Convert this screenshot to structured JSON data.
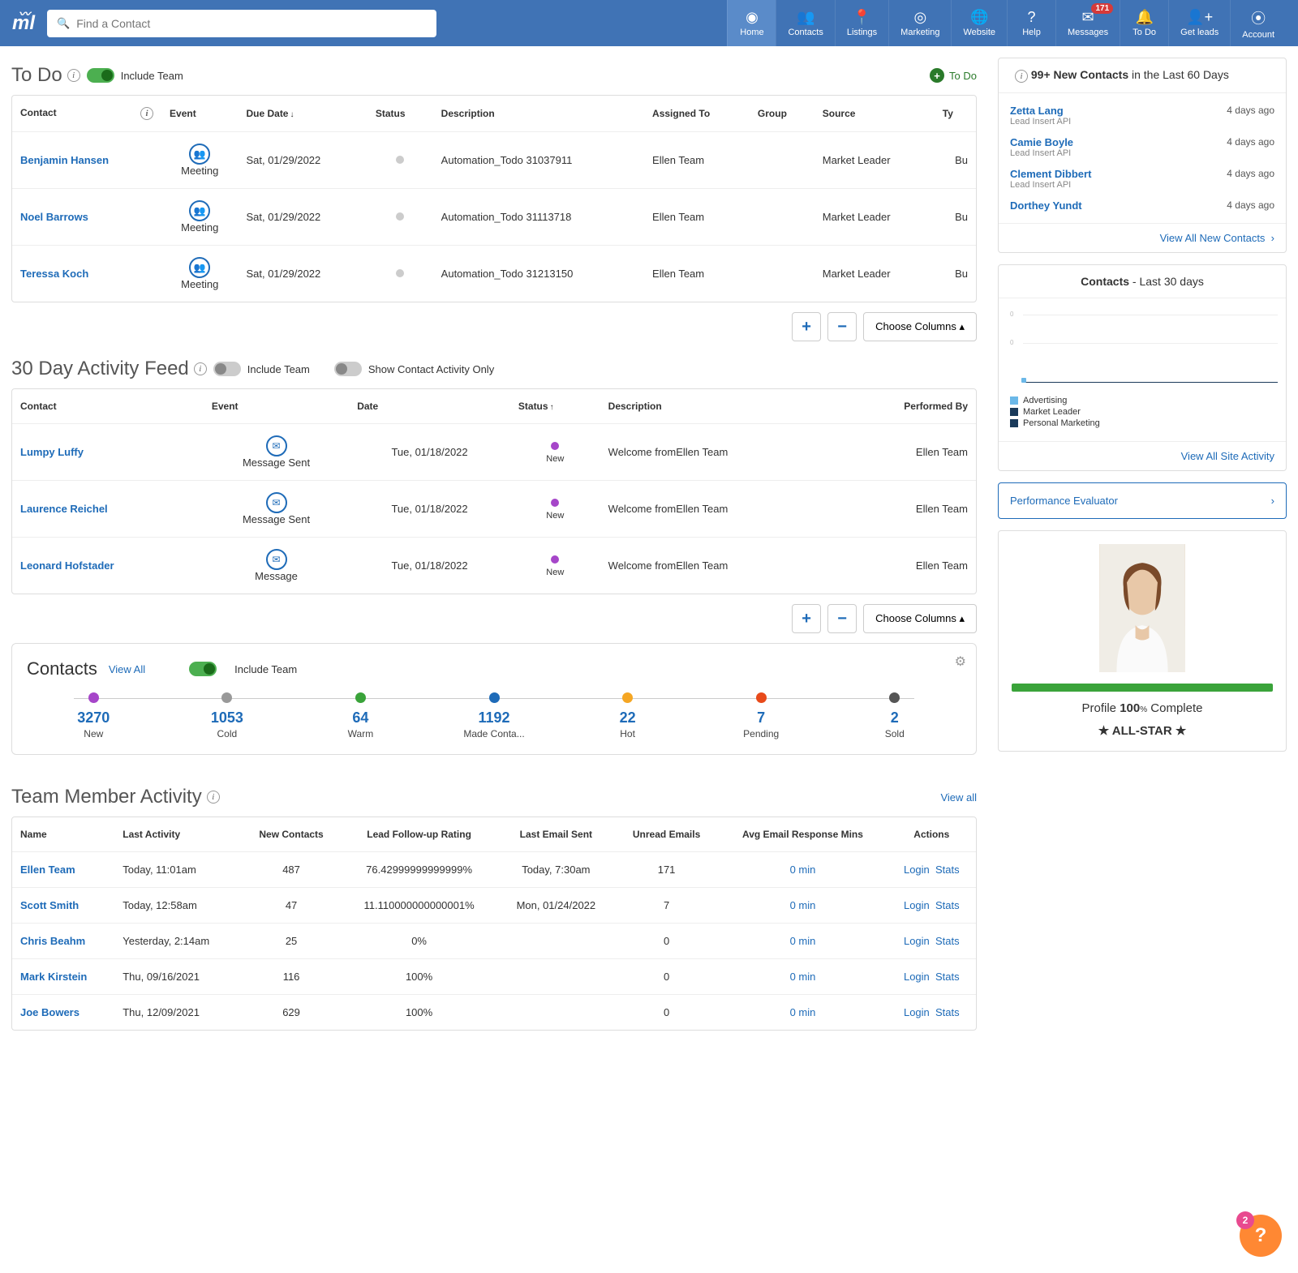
{
  "search": {
    "placeholder": "Find a Contact"
  },
  "topnav": [
    {
      "label": "Home",
      "icon": "◉",
      "active": true
    },
    {
      "label": "Contacts",
      "icon": "👥"
    },
    {
      "label": "Listings",
      "icon": "📍"
    },
    {
      "label": "Marketing",
      "icon": "◎"
    },
    {
      "label": "Website",
      "icon": "🌐"
    },
    {
      "label": "Help",
      "icon": "?"
    },
    {
      "label": "Messages",
      "icon": "✉",
      "badge": "171"
    },
    {
      "label": "To Do",
      "icon": "🔔"
    },
    {
      "label": "Get leads",
      "icon": "👤+"
    },
    {
      "label": "Account",
      "icon": "⦿"
    }
  ],
  "todo": {
    "title": "To Do",
    "include_team_label": "Include Team",
    "add_label": "To Do",
    "columns": [
      "Contact",
      "Event",
      "Due Date",
      "Status",
      "Description",
      "Assigned To",
      "Group",
      "Source",
      "Ty"
    ],
    "rows": [
      {
        "contact": "Benjamin Hansen",
        "event": "Meeting",
        "due": "Sat, 01/29/2022",
        "desc": "Automation_Todo 31037911",
        "assigned": "Ellen Team",
        "group": "",
        "source": "Market Leader",
        "type": "Bu"
      },
      {
        "contact": "Noel Barrows",
        "event": "Meeting",
        "due": "Sat, 01/29/2022",
        "desc": "Automation_Todo 31113718",
        "assigned": "Ellen Team",
        "group": "",
        "source": "Market Leader",
        "type": "Bu"
      },
      {
        "contact": "Teressa Koch",
        "event": "Meeting",
        "due": "Sat, 01/29/2022",
        "desc": "Automation_Todo 31213150",
        "assigned": "Ellen Team",
        "group": "",
        "source": "Market Leader",
        "type": "Bu"
      }
    ],
    "choose_columns": "Choose Columns"
  },
  "activity": {
    "title": "30 Day Activity Feed",
    "include_team_label": "Include Team",
    "contact_only_label": "Show Contact Activity Only",
    "columns": [
      "Contact",
      "Event",
      "Date",
      "Status",
      "Description",
      "Performed By"
    ],
    "rows": [
      {
        "contact": "Lumpy Luffy",
        "event": "Message Sent",
        "date": "Tue, 01/18/2022",
        "status": "New",
        "desc": "Welcome fromEllen Team",
        "by": "Ellen Team"
      },
      {
        "contact": "Laurence Reichel",
        "event": "Message Sent",
        "date": "Tue, 01/18/2022",
        "status": "New",
        "desc": "Welcome fromEllen Team",
        "by": "Ellen Team"
      },
      {
        "contact": "Leonard Hofstader",
        "event": "Message",
        "date": "Tue, 01/18/2022",
        "status": "New",
        "desc": "Welcome fromEllen Team",
        "by": "Ellen Team"
      }
    ],
    "choose_columns": "Choose Columns"
  },
  "contacts": {
    "title": "Contacts",
    "view_all": "View All",
    "include_team_label": "Include Team",
    "stages": [
      {
        "count": "3270",
        "name": "New",
        "color": "#a646c9"
      },
      {
        "count": "1053",
        "name": "Cold",
        "color": "#999"
      },
      {
        "count": "64",
        "name": "Warm",
        "color": "#3aa33a"
      },
      {
        "count": "1192",
        "name": "Made Conta...",
        "color": "#1e6bb8"
      },
      {
        "count": "22",
        "name": "Hot",
        "color": "#f5a623"
      },
      {
        "count": "7",
        "name": "Pending",
        "color": "#e84a1a"
      },
      {
        "count": "2",
        "name": "Sold",
        "color": "#555"
      }
    ]
  },
  "team": {
    "title": "Team Member Activity",
    "view_all": "View all",
    "columns": [
      "Name",
      "Last Activity",
      "New Contacts",
      "Lead Follow-up Rating",
      "Last Email Sent",
      "Unread Emails",
      "Avg Email Response Mins",
      "Actions"
    ],
    "rows": [
      {
        "name": "Ellen Team",
        "last": "Today, 11:01am",
        "new": "487",
        "rating": "76.42999999999999%",
        "sent": "Today, 7:30am",
        "unread": "171",
        "avg": "0 min"
      },
      {
        "name": "Scott Smith",
        "last": "Today, 12:58am",
        "new": "47",
        "rating": "11.110000000000001%",
        "sent": "Mon, 01/24/2022",
        "unread": "7",
        "avg": "0 min"
      },
      {
        "name": "Chris Beahm",
        "last": "Yesterday, 2:14am",
        "new": "25",
        "rating": "0%",
        "sent": "",
        "unread": "0",
        "avg": "0 min"
      },
      {
        "name": "Mark Kirstein",
        "last": "Thu, 09/16/2021",
        "new": "116",
        "rating": "100%",
        "sent": "",
        "unread": "0",
        "avg": "0 min"
      },
      {
        "name": "Joe Bowers",
        "last": "Thu, 12/09/2021",
        "new": "629",
        "rating": "100%",
        "sent": "",
        "unread": "0",
        "avg": "0 min"
      }
    ],
    "login": "Login",
    "stats": "Stats"
  },
  "new_contacts": {
    "header_bold": "99+ New Contacts",
    "header_rest": " in the Last 60 Days",
    "rows": [
      {
        "name": "Zetta Lang",
        "sub": "Lead Insert API",
        "time": "4 days ago"
      },
      {
        "name": "Camie Boyle",
        "sub": "Lead Insert API",
        "time": "4 days ago"
      },
      {
        "name": "Clement Dibbert",
        "sub": "Lead Insert API",
        "time": "4 days ago"
      },
      {
        "name": "Dorthey Yundt",
        "sub": "",
        "time": "4 days ago"
      }
    ],
    "footer": "View All New Contacts"
  },
  "contacts_chart": {
    "header_bold": "Contacts",
    "header_rest": " - Last 30 days",
    "legend": [
      {
        "label": "Advertising",
        "color": "#6bb8e8"
      },
      {
        "label": "Market Leader",
        "color": "#1a3a5a"
      },
      {
        "label": "Personal Marketing",
        "color": "#1a3a5a"
      }
    ],
    "footer": "View All Site Activity"
  },
  "perf": {
    "label": "Performance Evaluator"
  },
  "profile": {
    "text_pre": "Profile ",
    "pct": "100",
    "unit": "%",
    "text_post": " Complete",
    "allstar": "★ ALL-STAR ★"
  },
  "fab": {
    "badge": "2"
  },
  "chart_data": {
    "type": "line",
    "title": "Contacts - Last 30 days",
    "series": [
      {
        "name": "Advertising",
        "values": []
      },
      {
        "name": "Market Leader",
        "values": []
      },
      {
        "name": "Personal Marketing",
        "values": []
      }
    ]
  }
}
